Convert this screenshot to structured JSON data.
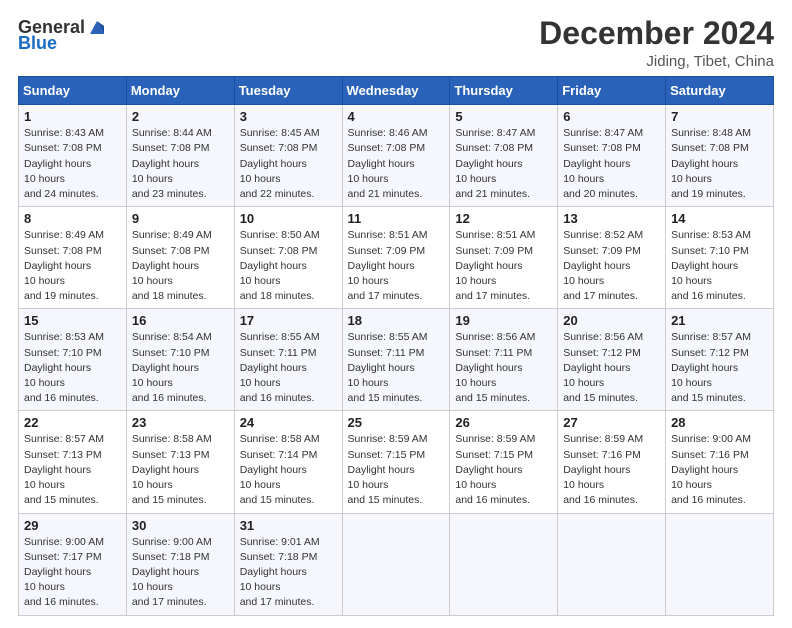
{
  "header": {
    "logo_general": "General",
    "logo_blue": "Blue",
    "title": "December 2024",
    "location": "Jiding, Tibet, China"
  },
  "calendar": {
    "days_of_week": [
      "Sunday",
      "Monday",
      "Tuesday",
      "Wednesday",
      "Thursday",
      "Friday",
      "Saturday"
    ],
    "weeks": [
      [
        null,
        null,
        null,
        null,
        {
          "day": "5",
          "sunrise": "8:47 AM",
          "sunset": "7:08 PM",
          "daylight": "10 hours and 21 minutes."
        },
        {
          "day": "6",
          "sunrise": "8:47 AM",
          "sunset": "7:08 PM",
          "daylight": "10 hours and 20 minutes."
        },
        {
          "day": "7",
          "sunrise": "8:48 AM",
          "sunset": "7:08 PM",
          "daylight": "10 hours and 19 minutes."
        }
      ],
      [
        {
          "day": "1",
          "sunrise": "8:43 AM",
          "sunset": "7:08 PM",
          "daylight": "10 hours and 24 minutes."
        },
        {
          "day": "2",
          "sunrise": "8:44 AM",
          "sunset": "7:08 PM",
          "daylight": "10 hours and 23 minutes."
        },
        {
          "day": "3",
          "sunrise": "8:45 AM",
          "sunset": "7:08 PM",
          "daylight": "10 hours and 22 minutes."
        },
        {
          "day": "4",
          "sunrise": "8:46 AM",
          "sunset": "7:08 PM",
          "daylight": "10 hours and 21 minutes."
        },
        {
          "day": "5",
          "sunrise": "8:47 AM",
          "sunset": "7:08 PM",
          "daylight": "10 hours and 21 minutes."
        },
        {
          "day": "6",
          "sunrise": "8:47 AM",
          "sunset": "7:08 PM",
          "daylight": "10 hours and 20 minutes."
        },
        {
          "day": "7",
          "sunrise": "8:48 AM",
          "sunset": "7:08 PM",
          "daylight": "10 hours and 19 minutes."
        }
      ],
      [
        {
          "day": "8",
          "sunrise": "8:49 AM",
          "sunset": "7:08 PM",
          "daylight": "10 hours and 19 minutes."
        },
        {
          "day": "9",
          "sunrise": "8:49 AM",
          "sunset": "7:08 PM",
          "daylight": "10 hours and 18 minutes."
        },
        {
          "day": "10",
          "sunrise": "8:50 AM",
          "sunset": "7:08 PM",
          "daylight": "10 hours and 18 minutes."
        },
        {
          "day": "11",
          "sunrise": "8:51 AM",
          "sunset": "7:09 PM",
          "daylight": "10 hours and 17 minutes."
        },
        {
          "day": "12",
          "sunrise": "8:51 AM",
          "sunset": "7:09 PM",
          "daylight": "10 hours and 17 minutes."
        },
        {
          "day": "13",
          "sunrise": "8:52 AM",
          "sunset": "7:09 PM",
          "daylight": "10 hours and 17 minutes."
        },
        {
          "day": "14",
          "sunrise": "8:53 AM",
          "sunset": "7:10 PM",
          "daylight": "10 hours and 16 minutes."
        }
      ],
      [
        {
          "day": "15",
          "sunrise": "8:53 AM",
          "sunset": "7:10 PM",
          "daylight": "10 hours and 16 minutes."
        },
        {
          "day": "16",
          "sunrise": "8:54 AM",
          "sunset": "7:10 PM",
          "daylight": "10 hours and 16 minutes."
        },
        {
          "day": "17",
          "sunrise": "8:55 AM",
          "sunset": "7:11 PM",
          "daylight": "10 hours and 16 minutes."
        },
        {
          "day": "18",
          "sunrise": "8:55 AM",
          "sunset": "7:11 PM",
          "daylight": "10 hours and 15 minutes."
        },
        {
          "day": "19",
          "sunrise": "8:56 AM",
          "sunset": "7:11 PM",
          "daylight": "10 hours and 15 minutes."
        },
        {
          "day": "20",
          "sunrise": "8:56 AM",
          "sunset": "7:12 PM",
          "daylight": "10 hours and 15 minutes."
        },
        {
          "day": "21",
          "sunrise": "8:57 AM",
          "sunset": "7:12 PM",
          "daylight": "10 hours and 15 minutes."
        }
      ],
      [
        {
          "day": "22",
          "sunrise": "8:57 AM",
          "sunset": "7:13 PM",
          "daylight": "10 hours and 15 minutes."
        },
        {
          "day": "23",
          "sunrise": "8:58 AM",
          "sunset": "7:13 PM",
          "daylight": "10 hours and 15 minutes."
        },
        {
          "day": "24",
          "sunrise": "8:58 AM",
          "sunset": "7:14 PM",
          "daylight": "10 hours and 15 minutes."
        },
        {
          "day": "25",
          "sunrise": "8:59 AM",
          "sunset": "7:15 PM",
          "daylight": "10 hours and 15 minutes."
        },
        {
          "day": "26",
          "sunrise": "8:59 AM",
          "sunset": "7:15 PM",
          "daylight": "10 hours and 16 minutes."
        },
        {
          "day": "27",
          "sunrise": "8:59 AM",
          "sunset": "7:16 PM",
          "daylight": "10 hours and 16 minutes."
        },
        {
          "day": "28",
          "sunrise": "9:00 AM",
          "sunset": "7:16 PM",
          "daylight": "10 hours and 16 minutes."
        }
      ],
      [
        {
          "day": "29",
          "sunrise": "9:00 AM",
          "sunset": "7:17 PM",
          "daylight": "10 hours and 16 minutes."
        },
        {
          "day": "30",
          "sunrise": "9:00 AM",
          "sunset": "7:18 PM",
          "daylight": "10 hours and 17 minutes."
        },
        {
          "day": "31",
          "sunrise": "9:01 AM",
          "sunset": "7:18 PM",
          "daylight": "10 hours and 17 minutes."
        },
        null,
        null,
        null,
        null
      ]
    ]
  }
}
